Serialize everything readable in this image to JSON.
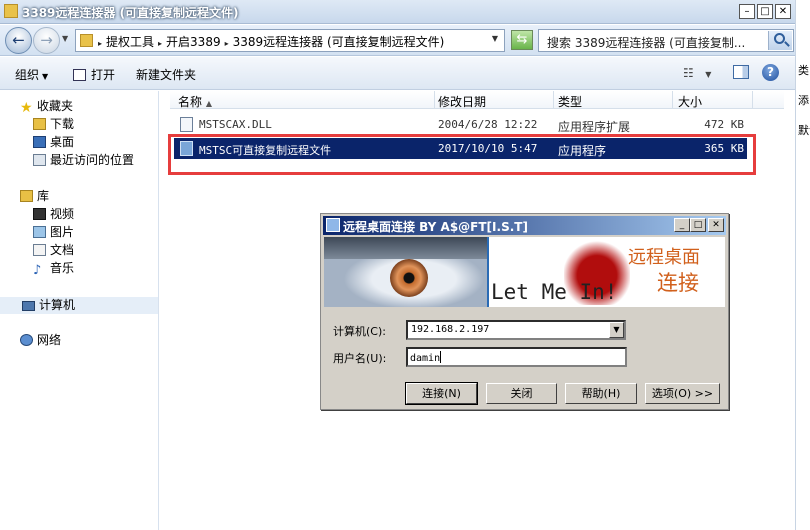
{
  "window": {
    "title": "3389远程连接器 (可直接复制远程文件)",
    "controls": {
      "minimize": "–",
      "maximize": "□",
      "close": "✕"
    }
  },
  "address": {
    "crumbs": [
      "提权工具",
      "开启3389",
      "3389远程连接器 (可直接复制远程文件)"
    ],
    "separator": "▸",
    "search_text": "搜索 3389远程连接器 (可直接复制..."
  },
  "toolbar": {
    "organize": "组织",
    "open": "打开",
    "new_folder": "新建文件夹"
  },
  "nav": {
    "favorites": "收藏夹",
    "favorites_items": [
      "下载",
      "桌面",
      "最近访问的位置"
    ],
    "libraries": "库",
    "library_items": [
      "视频",
      "图片",
      "文档",
      "音乐"
    ],
    "computer": "计算机",
    "network": "网络"
  },
  "columns": {
    "name": "名称",
    "modified": "修改日期",
    "type": "类型",
    "size": "大小"
  },
  "files": [
    {
      "name": "MSTSCAX.DLL",
      "modified": "2004/6/28 12:22",
      "type": "应用程序扩展",
      "size": "472 KB"
    },
    {
      "name": "MSTSC可直接复制远程文件",
      "modified": "2017/10/10 5:47",
      "type": "应用程序",
      "size": "365 KB"
    }
  ],
  "right_edge_text": [
    "类",
    "添",
    "默认"
  ],
  "dialog": {
    "title": "远程桌面连接 BY A$@FT[I.S.T]",
    "banner_english": "Let Me In!",
    "banner_cn_1": "远程桌面",
    "banner_cn_2": "连接",
    "computer_label": "计算机(C):",
    "computer_value": "192.168.2.197",
    "user_label": "用户名(U):",
    "user_value": "damin",
    "buttons": {
      "connect": "连接(N)",
      "close": "关闭",
      "help": "帮助(H)",
      "options": "选项(O) >>"
    }
  },
  "colors": {
    "selection": "#0a246a",
    "highlight_box": "#e63d3d",
    "banner_text": "#d1601c"
  }
}
